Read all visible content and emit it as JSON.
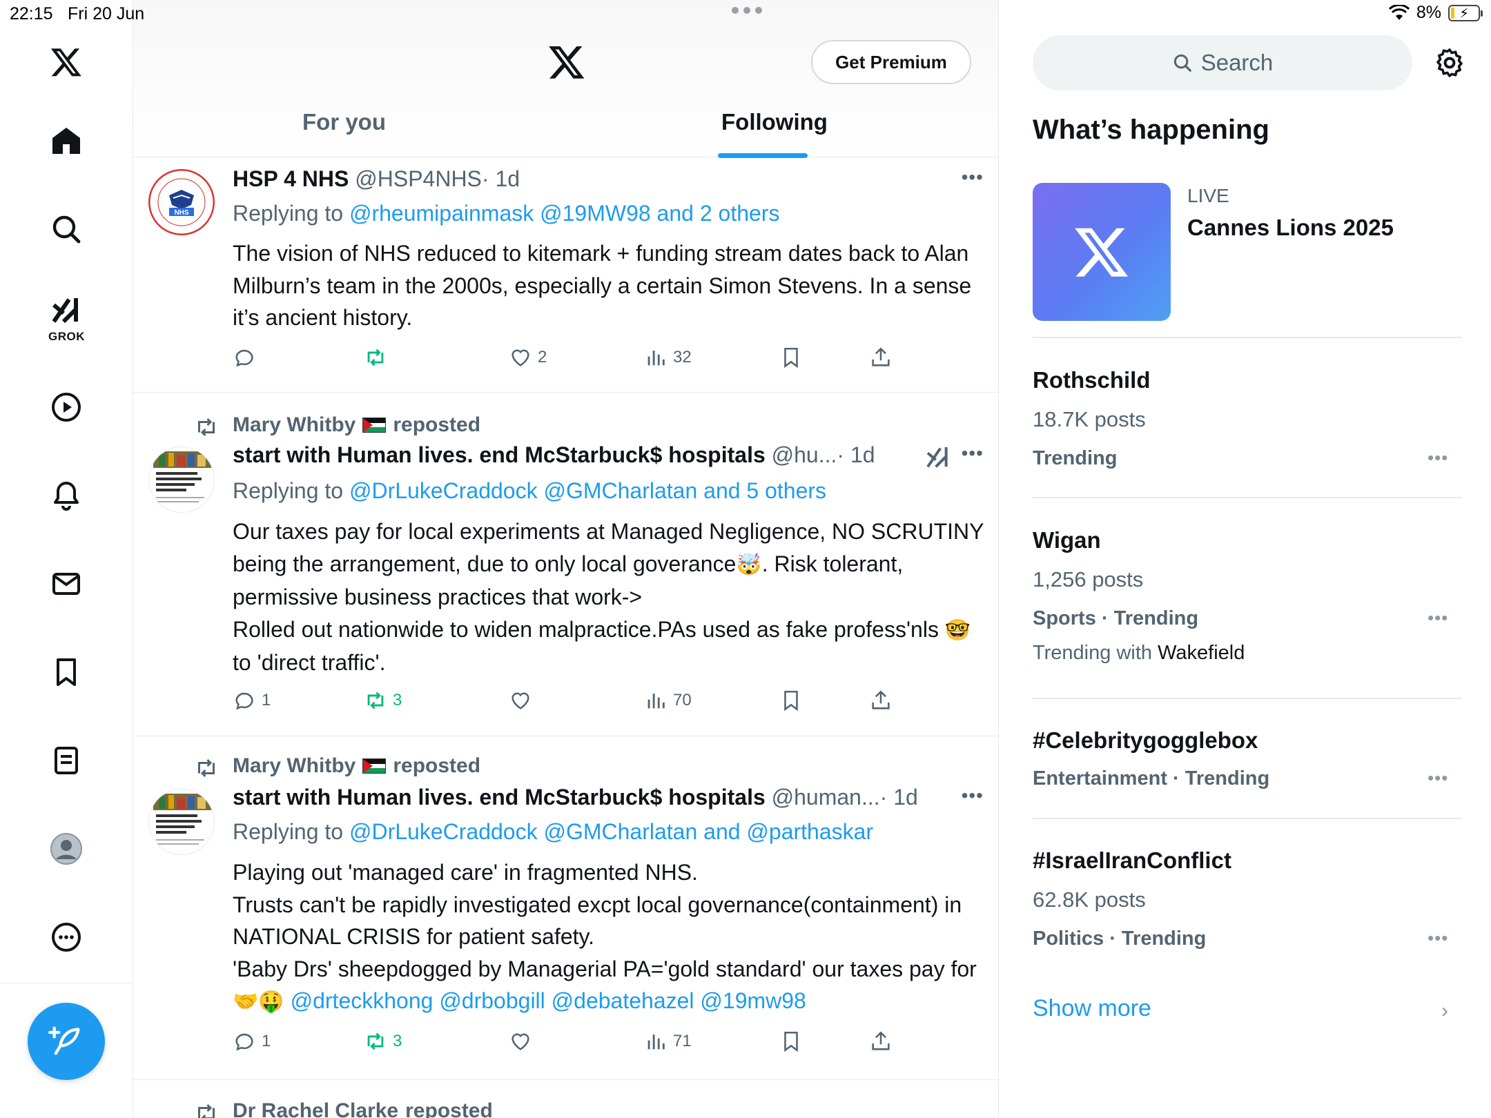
{
  "status_bar": {
    "time": "22:15",
    "date": "Fri 20 Jun",
    "battery": "8%"
  },
  "nav": {
    "grok_label": "GROK",
    "items": [
      "home-icon",
      "search-icon",
      "grok-icon",
      "video-icon",
      "notifications-icon",
      "messages-icon",
      "bookmarks-icon",
      "lists-icon",
      "profile-icon",
      "more-icon"
    ]
  },
  "header": {
    "premium_label": "Get Premium",
    "tabs": [
      {
        "label": "For you"
      },
      {
        "label": "Following"
      }
    ],
    "active_tab": "Following",
    "accent": "#1d9bf0"
  },
  "tweets": [
    {
      "name": "HSP 4 NHS",
      "handle": "@HSP4NHS",
      "time": "· 1d",
      "reply_prefix": "Replying to ",
      "reply_mentions": "@rheumipainmask @19MW98 and 2 others",
      "body": "The vision of NHS reduced to  kitemark + funding stream dates back to Alan Milburn’s team in the 2000s, especially a certain Simon Stevens. In a sense it’s ancient history.",
      "counts": {
        "replies": "",
        "reposts": "",
        "likes": "2",
        "views": "32"
      }
    },
    {
      "repost_by": "Mary Whitby",
      "repost_suffix": "reposted",
      "name": "start with Human lives. end McStarbuck$ hospitals",
      "handle": "@hu...",
      "time": "· 1d",
      "reply_prefix": "Replying to ",
      "reply_mentions": "@DrLukeCraddock @GMCharlatan and 5 others",
      "body_parts": [
        "Our taxes pay for local experiments at Managed Negligence, NO SCRUTINY being the arrangement, due to only local goverance",
        "🤯",
        ". Risk tolerant, permissive business practices that work->",
        "Rolled out nationwide to widen malpractice.PAs used as fake profess'nls ",
        "🤓",
        " to 'direct traffic'."
      ],
      "counts": {
        "replies": "1",
        "reposts": "3",
        "likes": "",
        "views": "70"
      }
    },
    {
      "repost_by": "Mary Whitby",
      "repost_suffix": "reposted",
      "name": "start with Human lives. end McStarbuck$ hospitals",
      "handle": "@human...",
      "time": "· 1d",
      "reply_prefix": "Replying to ",
      "reply_mentions": "@DrLukeCraddock @GMCharlatan and @parthaskar",
      "body_parts": [
        "Playing out 'managed care' in fragmented NHS.",
        "Trusts can't be rapidly investigated excpt local governance(containment) in NATIONAL CRISIS for patient safety.",
        "'Baby Drs' sheepdogged by Managerial PA='gold standard' our taxes pay for",
        "🤝🤑",
        " @drteckkhong @drbobgill @debatehazel @19mw98"
      ],
      "counts": {
        "replies": "1",
        "reposts": "3",
        "likes": "",
        "views": "71"
      }
    },
    {
      "repost_by": "Dr Rachel Clarke",
      "repost_suffix": "reposted"
    }
  ],
  "sidebar": {
    "search_placeholder": "Search",
    "whats_happening": "What’s happening",
    "live": {
      "label": "LIVE",
      "title": "Cannes Lions 2025"
    },
    "trends": [
      {
        "title": "Rothschild",
        "posts": "18.7K posts",
        "category": "Trending"
      },
      {
        "title": "Wigan",
        "posts": "1,256 posts",
        "category": "Sports · Trending",
        "with_prefix": "Trending with ",
        "with": "Wakefield"
      },
      {
        "title": "#Celebritygogglebox",
        "category": "Entertainment · Trending"
      },
      {
        "title": "#IsraelIranConflict",
        "posts": "62.8K posts",
        "category": "Politics · Trending"
      }
    ],
    "show_more": "Show more"
  }
}
